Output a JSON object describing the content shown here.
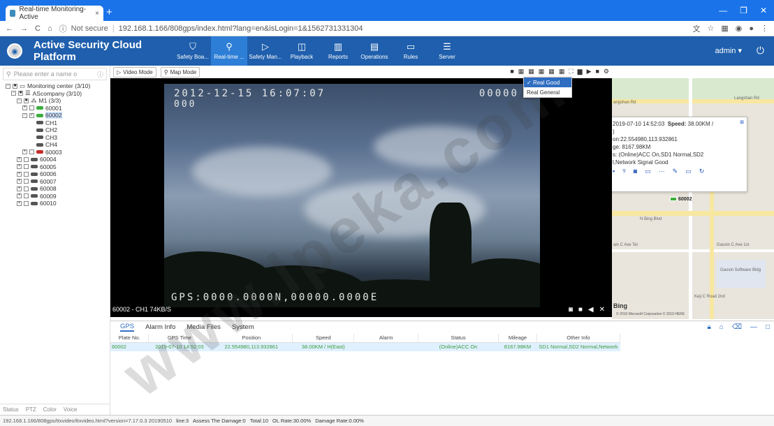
{
  "browser": {
    "tab_title": "Real-time Monitoring-Active",
    "tab_close": "×",
    "new_tab": "+",
    "not_secure": "Not secure",
    "url": "192.168.1.166/808gps/index.html?lang=en&isLogin=1&1562731331304"
  },
  "app": {
    "title": "Active Security Cloud Platform",
    "user": "admin ▾",
    "nav": [
      {
        "label": "Safety Boa...",
        "icon": "shield-icon"
      },
      {
        "label": "Real-time ...",
        "icon": "location-pin-icon"
      },
      {
        "label": "Safety Man...",
        "icon": "shield-play-icon"
      },
      {
        "label": "Playback",
        "icon": "playback-icon"
      },
      {
        "label": "Reports",
        "icon": "bar-chart-icon"
      },
      {
        "label": "Operations",
        "icon": "operations-icon"
      },
      {
        "label": "Rules",
        "icon": "rules-icon"
      },
      {
        "label": "Server",
        "icon": "server-icon"
      }
    ]
  },
  "left": {
    "search_placeholder": "Please enter a name o",
    "tree": [
      {
        "label": "Monitoring center (3/10)"
      },
      {
        "label": "AScompany (3/10)"
      },
      {
        "label": "M1 (3/3)"
      },
      {
        "label": "60001"
      },
      {
        "label": "60002"
      },
      {
        "label": "CH1"
      },
      {
        "label": "CH2"
      },
      {
        "label": "CH3"
      },
      {
        "label": "CH4"
      },
      {
        "label": "60003"
      },
      {
        "label": "60004"
      },
      {
        "label": "60005"
      },
      {
        "label": "60006"
      },
      {
        "label": "60007"
      },
      {
        "label": "60008"
      },
      {
        "label": "60009"
      },
      {
        "label": "60010"
      }
    ],
    "footer_tabs": [
      "Status",
      "PTZ",
      "Color",
      "Voice"
    ]
  },
  "toolbar": {
    "video_mode": "Video Mode",
    "map_mode": "Map Mode"
  },
  "dropdown": {
    "items": [
      "Real Good",
      "Real General"
    ],
    "selected": "Real Good"
  },
  "video": {
    "osd_datetime": "2012-12-15 16:07:07",
    "osd_counter": "00000",
    "osd_sub": "000",
    "osd_gps": "GPS:0000.0000N,00000.0000E",
    "label": "60002 - CH1 74KB/S"
  },
  "map": {
    "popup": {
      "time": "2019-07-10 14:52:03",
      "speed_label": "Speed:",
      "speed": "38.00KM /",
      "line2": ")",
      "position": "on:22.554980,113.932861",
      "mileage": "ge: 8167.98KM",
      "status": "s: (Online)ACC On,SD1 Normal,SD2",
      "status2": "l,Network Signal Good"
    },
    "labels": {
      "road1": "angshan Rd",
      "road2": "Langshan Rd",
      "road3": "N Bing Blvd",
      "road4": "ain C Ave Tel",
      "road5": "Gaoxin C Ave 1st",
      "road6": "Gaoxin Software Bldg",
      "road7": "Keji C Road 2nd",
      "marker": "60002",
      "bing": "Bing",
      "copyright": "© 2019 Microsoft Corporation © 2019 HERE"
    }
  },
  "bottom": {
    "tabs": [
      "GPS",
      "Alarm Info",
      "Media Files",
      "System"
    ],
    "columns": [
      "Plate No.",
      "GPS Time",
      "Position",
      "Speed",
      "Alarm",
      "Status",
      "Mileage",
      "Other Info"
    ],
    "rows": [
      [
        "60002",
        "2019-07-10 14:52:03",
        "22.554980,113.932861",
        "38.00KM / H(East)",
        "",
        "(Online)ACC On",
        "8167.98KM",
        "SD1 Normal,SD2 Normal,Network"
      ]
    ]
  },
  "status": {
    "url": "192.168.1.166/808gps/ttxvideo/ttxvideo.html?version=7.17.0.3 20190510",
    "online": "line:3",
    "assess": "Assess The Damage:0",
    "total": "Total:10",
    "ol_rate": "OL Rate:30.00%",
    "damage_rate": "Damage Rate:0.00%"
  },
  "watermark": "www.lpeka.com"
}
